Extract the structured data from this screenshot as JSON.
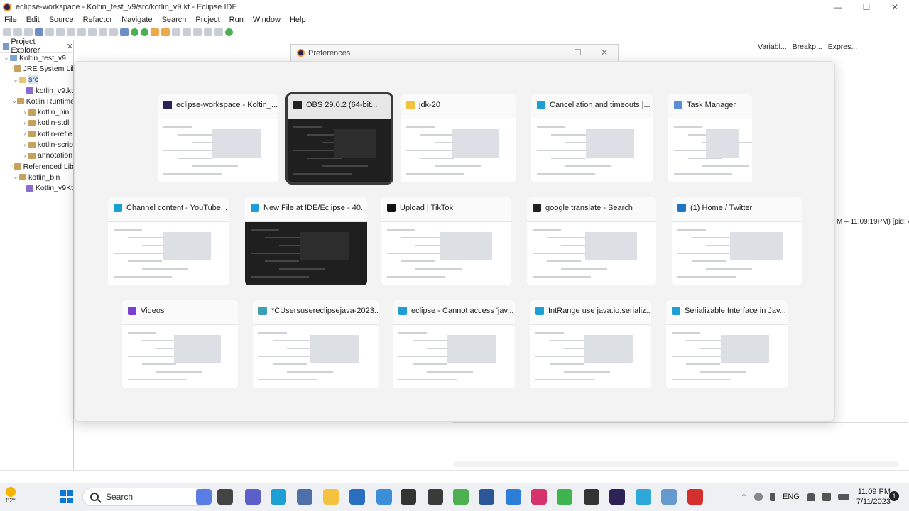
{
  "window": {
    "title": "eclipse-workspace - Koltin_test_v9/src/kotlin_v9.kt - Eclipse IDE",
    "controls": [
      "—",
      "☐",
      "✕"
    ]
  },
  "menu": [
    "File",
    "Edit",
    "Source",
    "Refactor",
    "Navigate",
    "Search",
    "Project",
    "Run",
    "Window",
    "Help"
  ],
  "explorer": {
    "title": "Project Explorer",
    "close": "✕",
    "items": [
      {
        "label": "Koltin_test_v9",
        "twist": "⌄",
        "indent": 0,
        "icon": "proj"
      },
      {
        "label": "JRE System Lib",
        "twist": "›",
        "indent": 1,
        "icon": "lib"
      },
      {
        "label": "src",
        "twist": "⌄",
        "indent": 1,
        "icon": "sel",
        "selected": true
      },
      {
        "label": "kotlin_v9.kt",
        "twist": "",
        "indent": 2,
        "icon": "file"
      },
      {
        "label": "Kotlin Runtime",
        "twist": "⌄",
        "indent": 1,
        "icon": "lib"
      },
      {
        "label": "kotlin_bin",
        "twist": "›",
        "indent": 2,
        "icon": "lib"
      },
      {
        "label": "kotlin-stdli",
        "twist": "›",
        "indent": 2,
        "icon": "lib"
      },
      {
        "label": "kotlin-refle",
        "twist": "›",
        "indent": 2,
        "icon": "lib"
      },
      {
        "label": "kotlin-scrip",
        "twist": "›",
        "indent": 2,
        "icon": "lib"
      },
      {
        "label": "annotation",
        "twist": "›",
        "indent": 2,
        "icon": "lib"
      },
      {
        "label": "Referenced Lib",
        "twist": "›",
        "indent": 1,
        "icon": "lib"
      },
      {
        "label": "kotlin_bin",
        "twist": "⌄",
        "indent": 1,
        "icon": "lib"
      },
      {
        "label": "Kotlin_v9Kt",
        "twist": "",
        "indent": 2,
        "icon": "file"
      }
    ]
  },
  "right_tabs": [
    "Variabl...",
    "Breakp...",
    "Expres..."
  ],
  "console_status": "M – 11:09:19PM) [pid: 4",
  "preferences": {
    "title": "Preferences",
    "max": "☐",
    "close": "✕"
  },
  "switcher": {
    "rows": [
      [
        {
          "title": "eclipse-workspace - Koltin_...",
          "icon_color": "#2c2255"
        },
        {
          "title": "OBS 29.0.2 (64-bit...",
          "icon_color": "#222222",
          "active": true
        },
        {
          "title": "jdk-20",
          "icon_color": "#f3c33f"
        },
        {
          "title": "Cancellation and timeouts |...",
          "icon_color": "#1d9fd6"
        },
        {
          "title": "Task Manager",
          "icon_color": "#5a8fd0"
        }
      ],
      [
        {
          "title": "Channel content - YouTube...",
          "icon_color": "#1d9fd6"
        },
        {
          "title": "New File at IDE/Eclipse - 40...",
          "icon_color": "#1d9fd6"
        },
        {
          "title": "Upload | TikTok",
          "icon_color": "#111111"
        },
        {
          "title": "google translate - Search",
          "icon_color": "#222222"
        },
        {
          "title": "(1) Home / Twitter",
          "icon_color": "#1d77c2"
        }
      ],
      [
        {
          "title": "Videos",
          "icon_color": "#7b3fd1"
        },
        {
          "title": "*CUsersusereclipsejava-2023...",
          "icon_color": "#3a9fb5"
        },
        {
          "title": "eclipse - Cannot access 'jav...",
          "icon_color": "#1d9fd6"
        },
        {
          "title": "IntRange use java.io.serializ...",
          "icon_color": "#1d9fd6"
        },
        {
          "title": "Serializable Interface in Jav...",
          "icon_color": "#1d9fd6"
        }
      ]
    ]
  },
  "taskbar": {
    "temperature": "82°",
    "search_placeholder": "Search",
    "language": "ENG",
    "time": "11:09 PM",
    "date": "7/11/2023",
    "apps": [
      {
        "name": "copilot",
        "color": "#5b7ee5"
      },
      {
        "name": "file-explorer-dark",
        "color": "#444"
      },
      {
        "name": "teams",
        "color": "#5b5fc7"
      },
      {
        "name": "edge",
        "color": "#1d9fd6"
      },
      {
        "name": "3d-box",
        "color": "#4e6fa8"
      },
      {
        "name": "file-explorer",
        "color": "#f3c33f"
      },
      {
        "name": "whiteboard",
        "color": "#2a6fbf"
      },
      {
        "name": "azure",
        "color": "#3b8ed8"
      },
      {
        "name": "terminal",
        "color": "#333"
      },
      {
        "name": "visual-studio",
        "color": "#3a3a3a"
      },
      {
        "name": "android-studio",
        "color": "#4caf50"
      },
      {
        "name": "word",
        "color": "#2b5797"
      },
      {
        "name": "vs-code-blue",
        "color": "#2c7ed6"
      },
      {
        "name": "intellij",
        "color": "#d6336c"
      },
      {
        "name": "line-chat",
        "color": "#3fb34f"
      },
      {
        "name": "obs",
        "color": "#333"
      },
      {
        "name": "eclipse",
        "color": "#2c2255"
      },
      {
        "name": "notepad",
        "color": "#2fa7d8"
      },
      {
        "name": "task-manager",
        "color": "#6699cc"
      },
      {
        "name": "chrome-recording",
        "color": "#d32f2f"
      }
    ]
  }
}
